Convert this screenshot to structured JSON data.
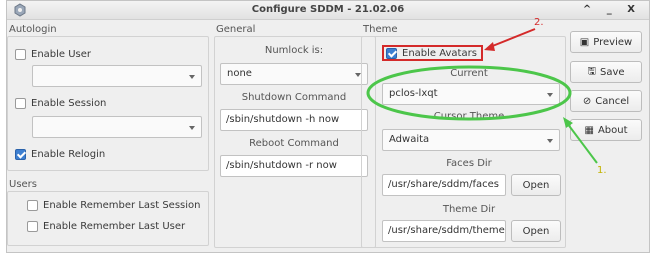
{
  "window": {
    "title": "Configure SDDM - 21.02.06",
    "controls": [
      "^",
      "_",
      "X"
    ]
  },
  "autologin": {
    "title": "Autologin",
    "enable_user": "Enable User",
    "enable_session": "Enable Session",
    "enable_relogin": "Enable Relogin",
    "enable_relogin_checked": true
  },
  "users": {
    "title": "Users",
    "remember_last_session": "Enable Remember Last Session",
    "remember_last_user": "Enable Remember Last User"
  },
  "general": {
    "title": "General",
    "numlock_label": "Numlock is:",
    "numlock_value": "none",
    "shutdown_label": "Shutdown Command",
    "shutdown_value": "/sbin/shutdown -h now",
    "reboot_label": "Reboot Command",
    "reboot_value": "/sbin/shutdown -r now"
  },
  "theme": {
    "title": "Theme",
    "enable_avatars": "Enable Avatars",
    "enable_avatars_checked": true,
    "current_label": "Current",
    "current_value": "pclos-lxqt",
    "cursor_label": "Cursor Theme",
    "cursor_value": "Adwaita",
    "faces_label": "Faces Dir",
    "faces_value": "/usr/share/sddm/faces",
    "theme_dir_label": "Theme Dir",
    "theme_dir_value": "/usr/share/sddm/themes",
    "open_label": "Open"
  },
  "actions": {
    "preview": "Preview",
    "save": "Save",
    "cancel": "Cancel",
    "about": "About"
  },
  "annotations": {
    "one": "1.",
    "two": "2."
  },
  "colors": {
    "accent": "#3d7fd1",
    "annotation_red": "#d42a2a",
    "annotation_green": "#4cc64a"
  }
}
